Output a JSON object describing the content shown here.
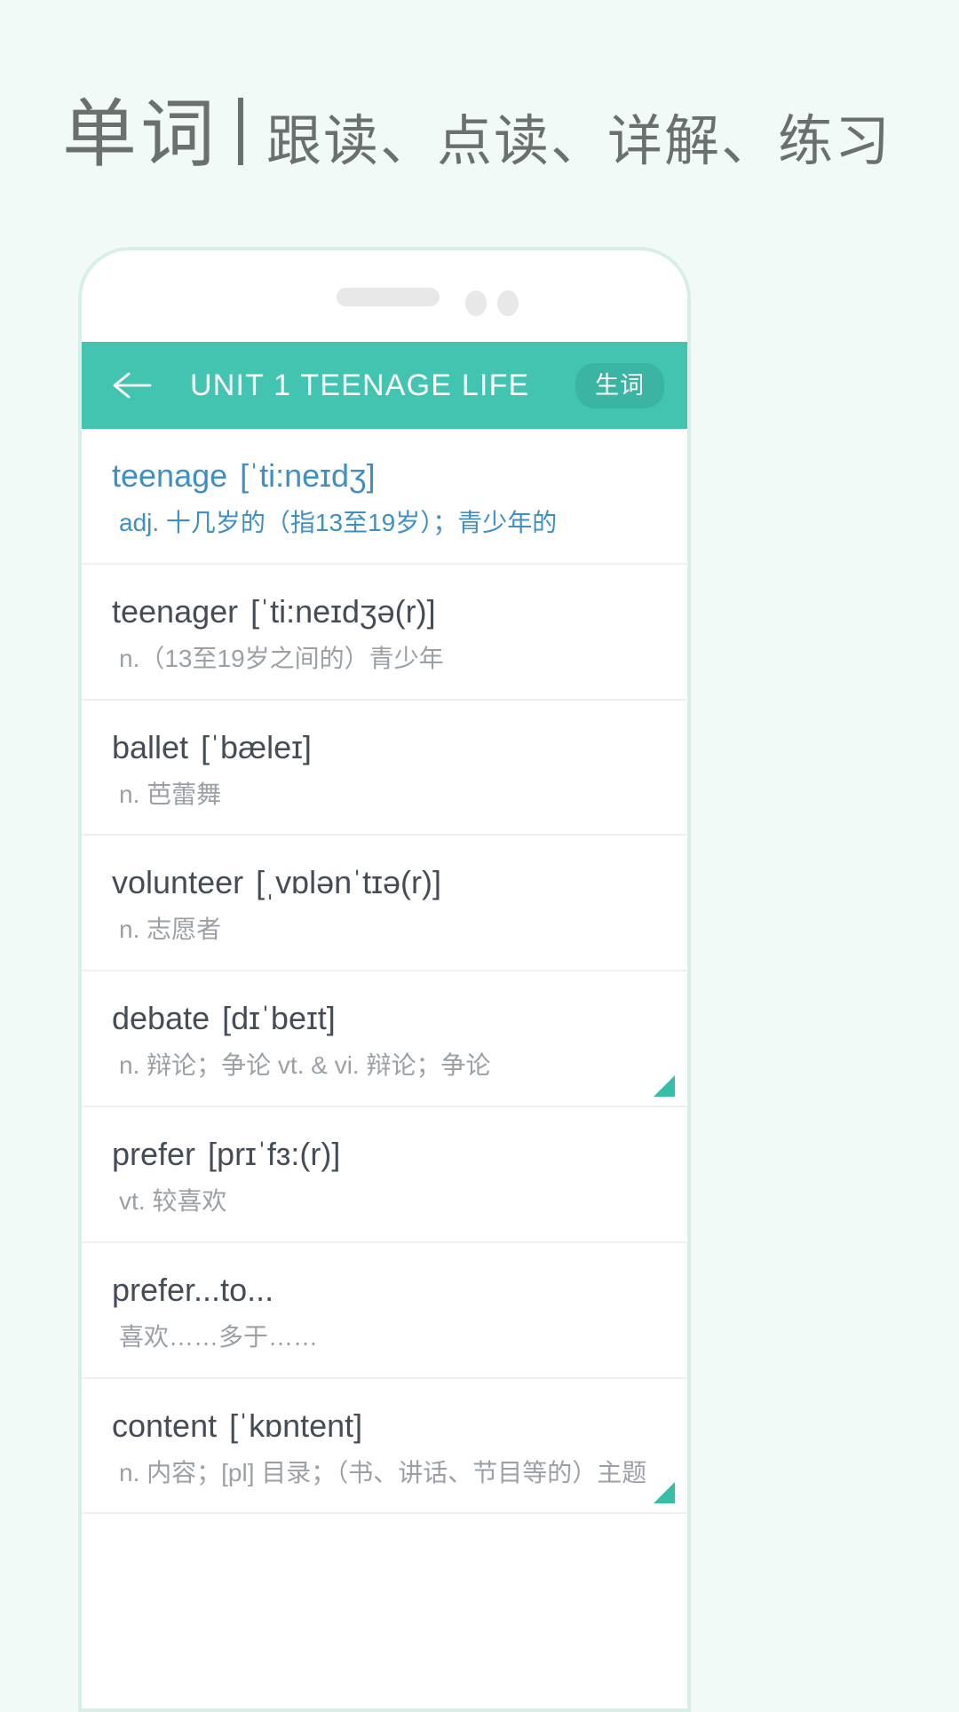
{
  "page": {
    "heading_main": "单词",
    "heading_sub": "跟读、点读、详解、练习",
    "background_color": "#f2faf7",
    "heading_color": "#6b6f6e"
  },
  "phone": {
    "notch": {
      "speaker_name": "speaker-bar",
      "camera_dots": 2
    }
  },
  "appbar": {
    "back_icon": "back-arrow-icon",
    "title": "UNIT 1 TEENAGE LIFE",
    "badge_label": "生词",
    "background_color": "#43c4b1",
    "badge_color": "#3cb4a3",
    "text_color": "#ffffff"
  },
  "words": [
    {
      "word": "teenage",
      "ipa": "[ˈti:neɪdʒ]",
      "definition": "adj. 十几岁的（指13至19岁）；青少年的",
      "active": true,
      "flag": false
    },
    {
      "word": "teenager",
      "ipa": "[ˈti:neɪdʒə(r)]",
      "definition": "n.（13至19岁之间的）青少年",
      "active": false,
      "flag": false
    },
    {
      "word": "ballet",
      "ipa": "[ˈbæleɪ]",
      "definition": "n. 芭蕾舞",
      "active": false,
      "flag": false
    },
    {
      "word": "volunteer",
      "ipa": "[ˌvɒlənˈtɪə(r)]",
      "definition": "n. 志愿者",
      "active": false,
      "flag": false
    },
    {
      "word": "debate",
      "ipa": "[dɪˈbeɪt]",
      "definition": "n. 辩论；争论 vt. & vi. 辩论；争论",
      "active": false,
      "flag": true
    },
    {
      "word": "prefer",
      "ipa": "[prɪˈfɜ:(r)]",
      "definition": "vt. 较喜欢",
      "active": false,
      "flag": false
    },
    {
      "word": "prefer...to...",
      "ipa": "",
      "definition": "喜欢……多于……",
      "active": false,
      "flag": false
    },
    {
      "word": "content",
      "ipa": "[ˈkɒntent]",
      "definition": "n. 内容；[pl] 目录；（书、讲话、节目等的）主题",
      "active": false,
      "flag": true
    }
  ],
  "colors": {
    "accent": "#43c4b1",
    "active_text": "#3d8fc4",
    "word_text": "#444d57",
    "definition_text": "#9aa0a6",
    "flag": "#35bfa9"
  }
}
